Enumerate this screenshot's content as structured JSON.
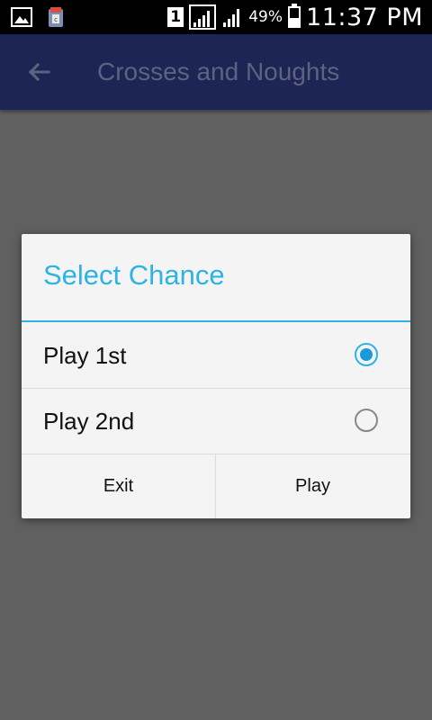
{
  "status_bar": {
    "sim_slot": "1",
    "battery_percent": "49%",
    "time": "11:37 PM",
    "icons": [
      "image-notification-icon",
      "app-notification-icon",
      "sim-icon",
      "signal-strength-icon",
      "signal-strength-2-icon",
      "battery-icon"
    ]
  },
  "app_bar": {
    "title": "Crosses and Noughts",
    "background_color": "#1c2554"
  },
  "dialog": {
    "title": "Select Chance",
    "accent_color": "#2fb3e4",
    "options": [
      {
        "label": "Play 1st",
        "selected": true
      },
      {
        "label": "Play 2nd",
        "selected": false
      }
    ],
    "buttons": {
      "exit_label": "Exit",
      "play_label": "Play"
    }
  }
}
